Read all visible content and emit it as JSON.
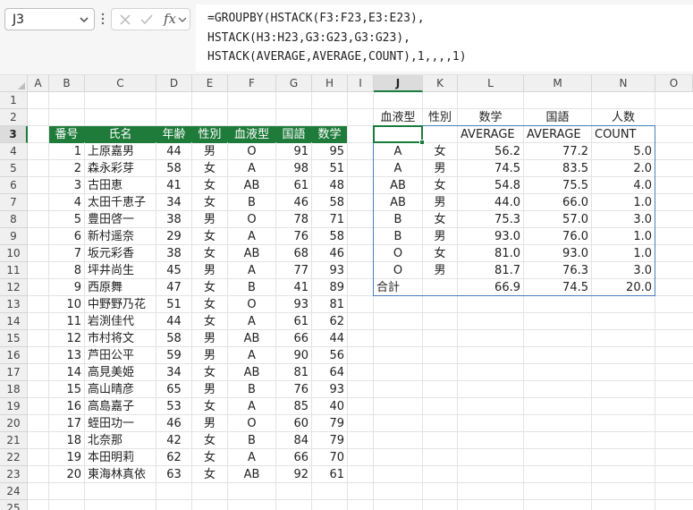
{
  "name_box": {
    "value": "J3"
  },
  "formula_bar": {
    "fx_label": "fx",
    "lines": [
      "=GROUPBY(HSTACK(F3:F23,E3:E23),",
      "HSTACK(H3:H23,G3:G23,G3:G23),",
      "HSTACK(AVERAGE,AVERAGE,COUNT),1,,,,1)"
    ]
  },
  "columns": [
    "A",
    "B",
    "C",
    "D",
    "E",
    "F",
    "G",
    "H",
    "I",
    "J",
    "K",
    "L",
    "M",
    "N",
    "O"
  ],
  "rows": [
    "1",
    "2",
    "3",
    "4",
    "5",
    "6",
    "7",
    "8",
    "9",
    "10",
    "11",
    "12",
    "13",
    "14",
    "15",
    "16",
    "17",
    "18",
    "19",
    "20",
    "21",
    "22",
    "23",
    "24",
    "25"
  ],
  "selected": {
    "column": "J",
    "row": "3"
  },
  "student_table": {
    "headers": [
      "番号",
      "氏名",
      "年齢",
      "性別",
      "血液型",
      "国語",
      "数学"
    ],
    "rows": [
      [
        "1",
        "上原嘉男",
        "44",
        "男",
        "O",
        "91",
        "95"
      ],
      [
        "2",
        "森永彩芽",
        "58",
        "女",
        "A",
        "98",
        "51"
      ],
      [
        "3",
        "古田恵",
        "41",
        "女",
        "AB",
        "61",
        "48"
      ],
      [
        "4",
        "太田千恵子",
        "34",
        "女",
        "B",
        "46",
        "58"
      ],
      [
        "5",
        "豊田啓一",
        "38",
        "男",
        "O",
        "78",
        "71"
      ],
      [
        "6",
        "新村遥奈",
        "29",
        "女",
        "A",
        "76",
        "58"
      ],
      [
        "7",
        "坂元彩香",
        "38",
        "女",
        "AB",
        "68",
        "46"
      ],
      [
        "8",
        "坪井尚生",
        "45",
        "男",
        "A",
        "77",
        "93"
      ],
      [
        "9",
        "西原舞",
        "47",
        "女",
        "B",
        "41",
        "89"
      ],
      [
        "10",
        "中野野乃花",
        "51",
        "女",
        "O",
        "93",
        "81"
      ],
      [
        "11",
        "岩渕佳代",
        "44",
        "女",
        "A",
        "61",
        "62"
      ],
      [
        "12",
        "市村将文",
        "58",
        "男",
        "AB",
        "66",
        "44"
      ],
      [
        "13",
        "芦田公平",
        "59",
        "男",
        "A",
        "90",
        "56"
      ],
      [
        "14",
        "高見美姫",
        "34",
        "女",
        "AB",
        "81",
        "64"
      ],
      [
        "15",
        "高山晴彦",
        "65",
        "男",
        "B",
        "76",
        "93"
      ],
      [
        "16",
        "高島嘉子",
        "53",
        "女",
        "A",
        "85",
        "40"
      ],
      [
        "17",
        "蛭田功一",
        "46",
        "男",
        "O",
        "60",
        "79"
      ],
      [
        "18",
        "北奈那",
        "42",
        "女",
        "B",
        "84",
        "79"
      ],
      [
        "19",
        "本田明莉",
        "62",
        "女",
        "A",
        "66",
        "70"
      ],
      [
        "20",
        "東海林真依",
        "63",
        "女",
        "AB",
        "92",
        "61"
      ]
    ]
  },
  "groupby_result": {
    "header_row": [
      "血液型",
      "性別",
      "数学",
      "国語",
      "人数"
    ],
    "func_row": [
      "",
      "",
      "AVERAGE",
      "AVERAGE",
      "COUNT"
    ],
    "rows": [
      [
        "A",
        "女",
        "56.2",
        "77.2",
        "5.0"
      ],
      [
        "A",
        "男",
        "74.5",
        "83.5",
        "2.0"
      ],
      [
        "AB",
        "女",
        "54.8",
        "75.5",
        "4.0"
      ],
      [
        "AB",
        "男",
        "44.0",
        "66.0",
        "1.0"
      ],
      [
        "B",
        "女",
        "75.3",
        "57.0",
        "3.0"
      ],
      [
        "B",
        "男",
        "93.0",
        "76.0",
        "1.0"
      ],
      [
        "O",
        "女",
        "81.0",
        "93.0",
        "1.0"
      ],
      [
        "O",
        "男",
        "81.7",
        "76.3",
        "3.0"
      ]
    ],
    "total_row": [
      "合計",
      "",
      "66.9",
      "74.5",
      "20.0"
    ]
  }
}
